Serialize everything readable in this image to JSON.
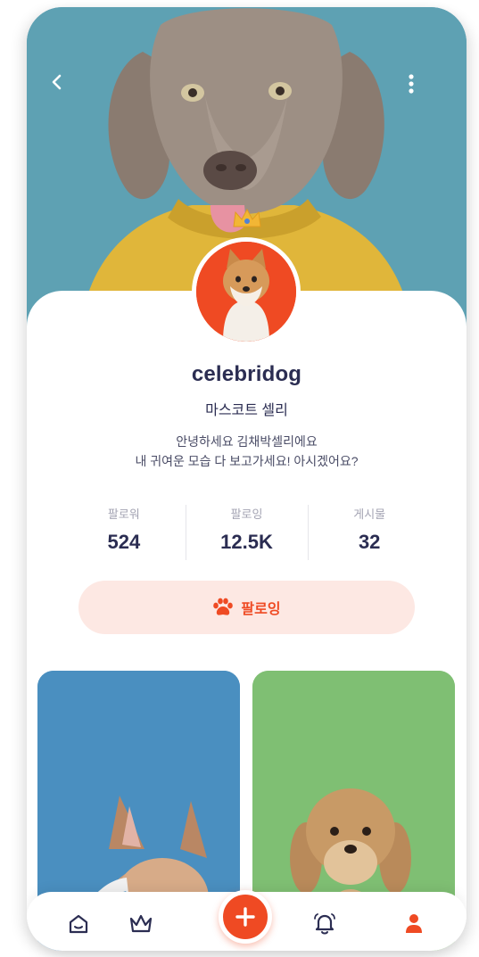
{
  "profile": {
    "username": "celebridog",
    "display_name": "마스코트 셀리",
    "bio_line1": "안녕하세요 김채박셀리에요",
    "bio_line2": "내 귀여운 모습 다 보고가세요! 아시겠어요?"
  },
  "stats": [
    {
      "label": "팔로워",
      "value": "524"
    },
    {
      "label": "팔로잉",
      "value": "12.5K"
    },
    {
      "label": "게시물",
      "value": "32"
    }
  ],
  "follow_button": {
    "label": "팔로잉",
    "icon": "paw-icon"
  },
  "header": {
    "back_icon": "chevron-left-icon",
    "more_icon": "more-vertical-icon"
  },
  "posts": [
    {
      "name": "post-french-bulldog",
      "bg": "#4a8fc0"
    },
    {
      "name": "post-poodle",
      "bg": "#7fbf73"
    }
  ],
  "bottom_nav": [
    {
      "name": "home",
      "icon": "home-icon",
      "active": false
    },
    {
      "name": "ranking",
      "icon": "crown-icon",
      "active": false
    },
    {
      "name": "create",
      "icon": "plus-icon",
      "active": false
    },
    {
      "name": "notifications",
      "icon": "bell-icon",
      "active": false
    },
    {
      "name": "profile",
      "icon": "user-icon",
      "active": true
    }
  ],
  "colors": {
    "accent": "#ef4a23",
    "accent_soft": "#fde8e3",
    "text_primary": "#2b2d52",
    "text_muted": "#a4a4b3",
    "hero_bg": "#5ea1b3"
  }
}
